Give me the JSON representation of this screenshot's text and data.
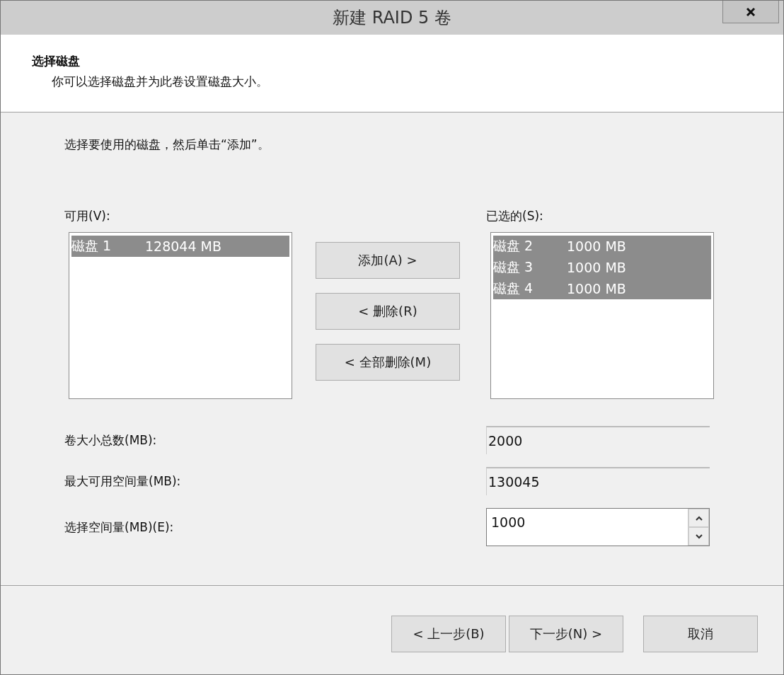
{
  "window": {
    "title": "新建 RAID 5 卷"
  },
  "header": {
    "title": "选择磁盘",
    "subtitle": "你可以选择磁盘并为此卷设置磁盘大小。"
  },
  "instruction": "选择要使用的磁盘，然后单击“添加”。",
  "available": {
    "label": "可用(V):",
    "items": [
      {
        "disk": "磁盘 1",
        "size": "128044 MB",
        "selected": true
      }
    ]
  },
  "actions": [
    "添加(A) >",
    "< 删除(R)",
    "< 全部删除(M)"
  ],
  "chosen": {
    "label": "已选的(S):",
    "items": [
      {
        "disk": "磁盘 2",
        "size": "1000 MB",
        "selected": true
      },
      {
        "disk": "磁盘 3",
        "size": "1000 MB",
        "selected": true
      },
      {
        "disk": "磁盘 4",
        "size": "1000 MB",
        "selected": true
      }
    ]
  },
  "fields": [
    {
      "kind": "readonly",
      "label": "卷大小总数(MB):",
      "value": "2000"
    },
    {
      "kind": "readonly",
      "label": "最大可用空间量(MB):",
      "value": "130045"
    },
    {
      "kind": "spin",
      "label": "选择空间量(MB)(E):",
      "value": "1000"
    }
  ],
  "buttons": [
    "< 上一步(B)",
    "下一步(N) >",
    "取消"
  ]
}
